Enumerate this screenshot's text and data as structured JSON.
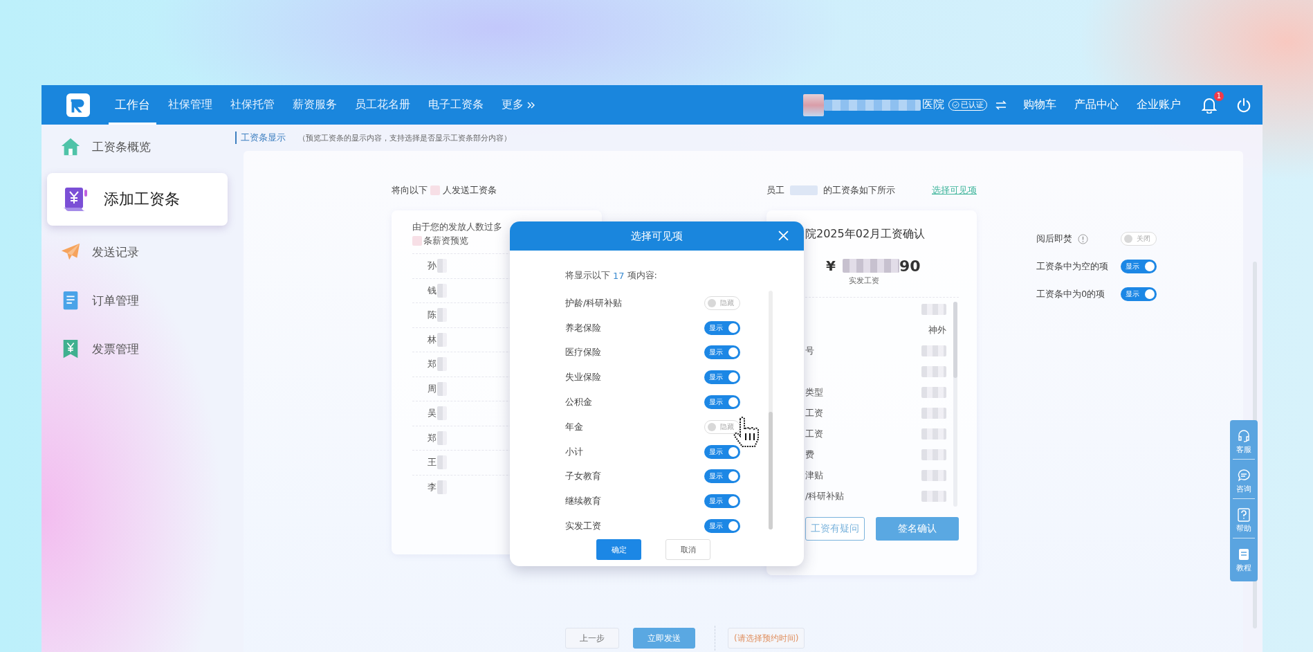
{
  "header": {
    "nav": [
      {
        "label": "工作台",
        "selected": true
      },
      {
        "label": "社保管理",
        "selected": false
      },
      {
        "label": "社保托管",
        "selected": false
      },
      {
        "label": "薪资服务",
        "selected": false
      },
      {
        "label": "员工花名册",
        "selected": false
      },
      {
        "label": "电子工资条",
        "selected": false
      },
      {
        "label": "更多",
        "selected": false
      }
    ],
    "org_suffix": "医院",
    "verified": "已认证",
    "links": [
      "购物车",
      "产品中心",
      "企业账户"
    ],
    "notifications": "1"
  },
  "sidebar": [
    {
      "label": "工资条概览",
      "selected": false
    },
    {
      "label": "添加工资条",
      "selected": true
    },
    {
      "label": "发送记录",
      "selected": false
    },
    {
      "label": "订单管理",
      "selected": false
    },
    {
      "label": "发票管理",
      "selected": false
    }
  ],
  "section": {
    "title": "工资条显示",
    "hint": "（预览工资条的显示内容，支持选择是否显示工资条部分内容）"
  },
  "recipients": {
    "heading_before": "将向以下",
    "heading_after": "人发送工资条",
    "notice_1": "由于您的发放人数过多",
    "notice_2": "条薪资预览",
    "names": [
      "孙",
      "钱",
      "陈",
      "林",
      "郑",
      "周",
      "吴",
      "郑",
      "王",
      "李"
    ]
  },
  "preview": {
    "heading_before": "员工",
    "heading_after": "的工资条如下所示",
    "link": "选择可见项",
    "title": "院2025年02月工资确认",
    "currency": "¥",
    "amount_end": "90",
    "amount_label": "实发工资",
    "rows": [
      {},
      {
        "value": "神外"
      },
      {
        "label": "号"
      },
      {},
      {
        "label": "类型"
      },
      {
        "label": "工资"
      },
      {
        "label": "工资"
      },
      {
        "label": "费"
      },
      {
        "label": "津贴"
      },
      {
        "label": "/科研补贴"
      }
    ],
    "buttons": [
      {
        "label": "工资有疑问",
        "kind": "outline"
      },
      {
        "label": "签名确认",
        "kind": "primary"
      }
    ]
  },
  "settings": [
    {
      "label": "阅后即焚",
      "info": true,
      "on": false,
      "state_text": "关闭"
    },
    {
      "label": "工资条中为空的项",
      "info": false,
      "on": true,
      "state_text": "显示"
    },
    {
      "label": "工资条中为0的项",
      "info": false,
      "on": true,
      "state_text": "显示"
    }
  ],
  "dialog": {
    "title": "选择可见项",
    "summary_before": "将显示以下",
    "count": "17",
    "summary_after": "项内容:",
    "items": [
      {
        "label": "护龄/科研补贴",
        "on": false,
        "state_text": "隐藏"
      },
      {
        "label": "养老保险",
        "on": true,
        "state_text": "显示"
      },
      {
        "label": "医疗保险",
        "on": true,
        "state_text": "显示"
      },
      {
        "label": "失业保险",
        "on": true,
        "state_text": "显示"
      },
      {
        "label": "公积金",
        "on": true,
        "state_text": "显示"
      },
      {
        "label": "年金",
        "on": false,
        "state_text": "隐藏"
      },
      {
        "label": "小计",
        "on": true,
        "state_text": "显示"
      },
      {
        "label": "子女教育",
        "on": true,
        "state_text": "显示"
      },
      {
        "label": "继续教育",
        "on": true,
        "state_text": "显示"
      },
      {
        "label": "实发工资",
        "on": true,
        "state_text": "显示"
      }
    ],
    "buttons": [
      {
        "label": "确定",
        "kind": "primary"
      },
      {
        "label": "取消",
        "kind": "default"
      }
    ]
  },
  "help_dock": [
    "客服",
    "咨询",
    "帮助",
    "教程"
  ],
  "footer": {
    "prev": "上一步",
    "send": "立即发送",
    "schedule": "(请选择预约时间)"
  }
}
